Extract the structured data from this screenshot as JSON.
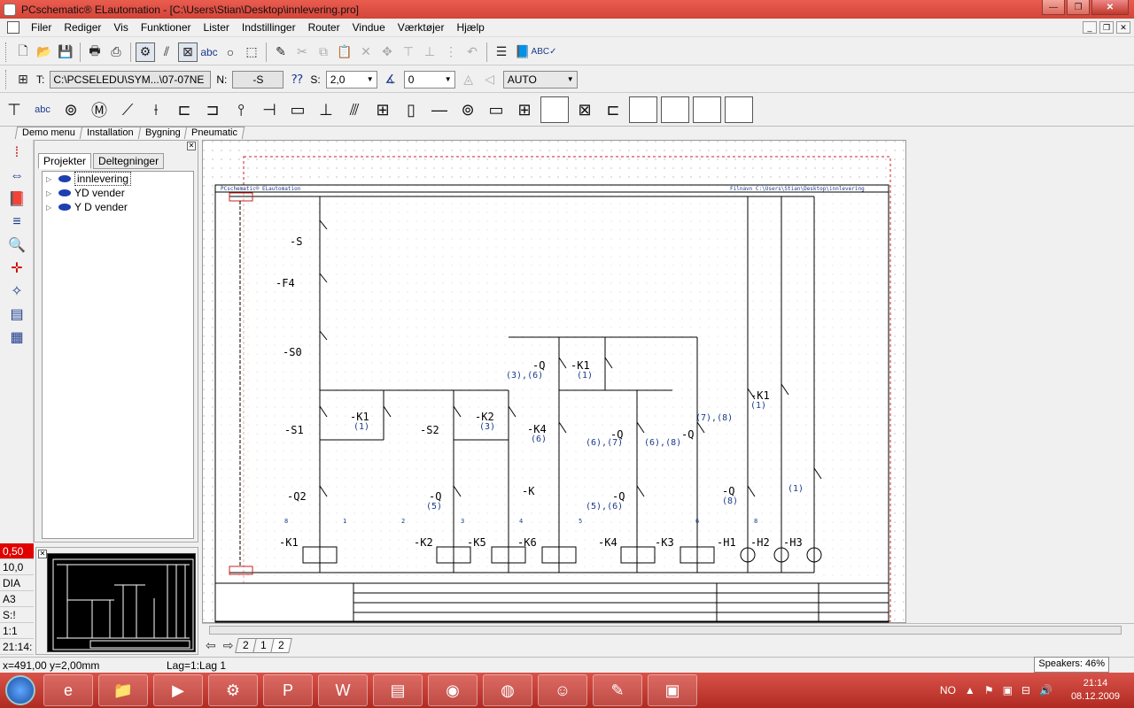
{
  "window": {
    "title": "PCschematic® ELautomation - [C:\\Users\\Stian\\Desktop\\innlevering.pro]"
  },
  "menu": [
    "Filer",
    "Rediger",
    "Vis",
    "Funktioner",
    "Lister",
    "Indstillinger",
    "Router",
    "Vindue",
    "Værktøjer",
    "Hjælp"
  ],
  "toolbar2": {
    "t_label": "T:",
    "t_value": "C:\\PCSELEDU\\SYM...\\07-07NE",
    "n_label": "N:",
    "n_value": "-S",
    "s_label": "S:",
    "s_value": "2,0",
    "angle_value": "0",
    "mode_value": "AUTO"
  },
  "design_tabs": [
    "Demo menu",
    "Installation",
    "Bygning",
    "Pneumatic"
  ],
  "project_panel": {
    "tabs": [
      "Projekter",
      "Deltegninger"
    ],
    "items": [
      "innlevering",
      "YD vender",
      "Y D vender"
    ]
  },
  "status_cells": [
    "0,50",
    "10,0",
    "DIA",
    "A3",
    "S:!",
    "1:1",
    "21:14:"
  ],
  "page_tabs": [
    "2",
    "1",
    "2"
  ],
  "statusbar": {
    "coords": "x=491,00 y=2,00mm",
    "layer": "Lag=1:Lag 1"
  },
  "speakers": "Speakers: 46%",
  "tray": {
    "lang": "NO",
    "time": "21:14",
    "date": "08.12.2009"
  },
  "schematic": {
    "header_left": "PCschematic® ELautomation",
    "header_right": "Filnavn  C:\\Users\\Stian\\Desktop\\innlevering",
    "labels": [
      "-S",
      "-F4",
      "-S0",
      "-S1",
      "-K1",
      "-S2",
      "-K2",
      "-Q",
      "-K1",
      "-K4",
      "-Q",
      "-Q",
      "-K",
      "-Q",
      "-Q",
      "-K1",
      "-Q",
      "-Q2",
      "-K1",
      "-K2",
      "-K5",
      "-K6",
      "-K4",
      "-K3",
      "-H1",
      "-H2",
      "-H3"
    ],
    "refs": [
      "(1)",
      "(3)",
      "(3),(6)",
      "(1)",
      "(6)",
      "(6),(7)",
      "(6),(8)",
      "(7),(8)",
      "(1)",
      "(5)",
      "(5),(6)",
      "(8)",
      "(1)"
    ],
    "columns": [
      "8",
      "1",
      "2",
      "3",
      "4",
      "5",
      "6",
      "8"
    ]
  }
}
